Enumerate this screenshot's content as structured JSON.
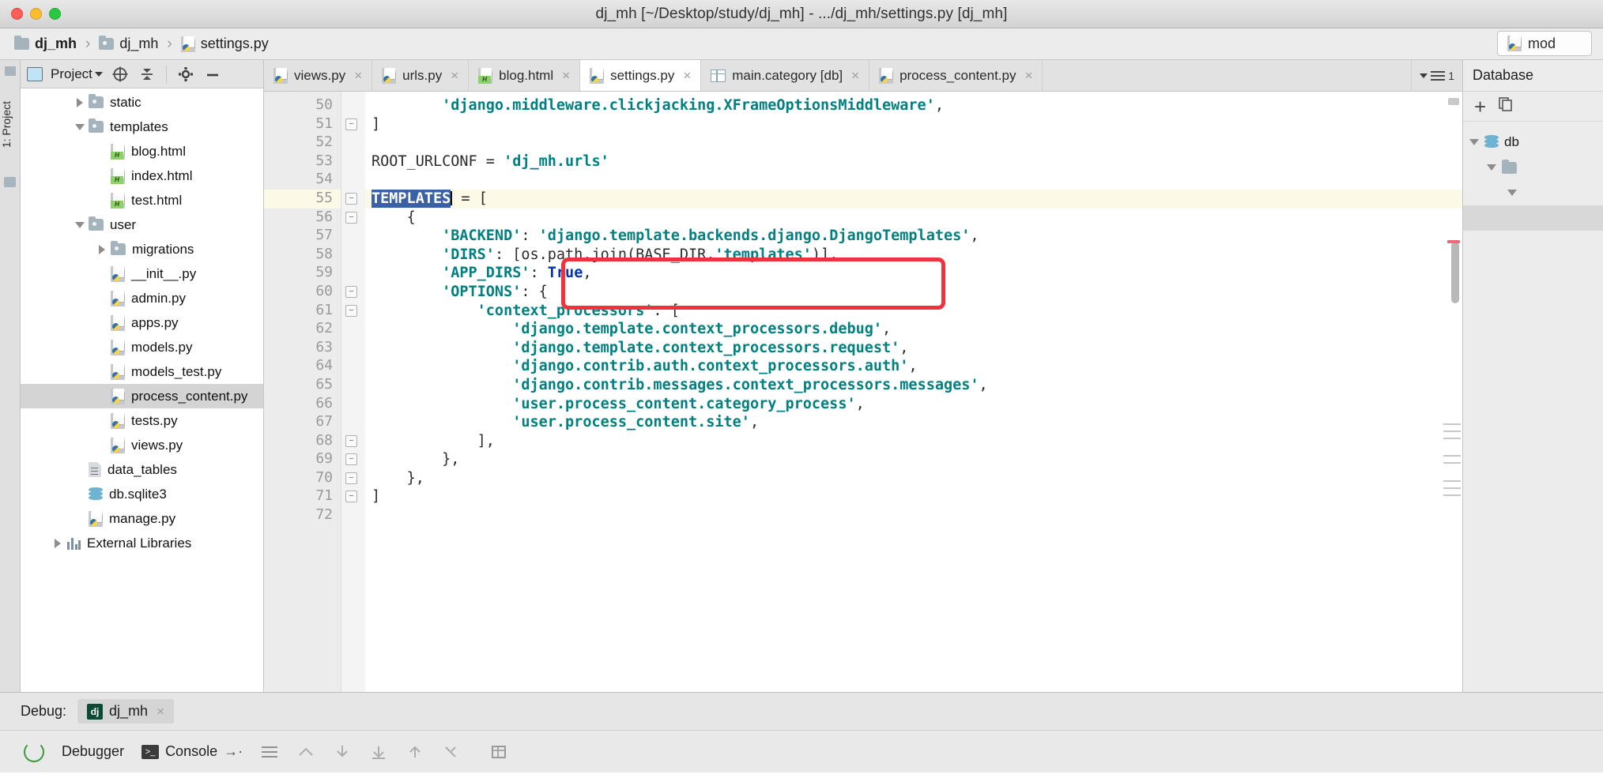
{
  "window": {
    "title": "dj_mh [~/Desktop/study/dj_mh] - .../dj_mh/settings.py [dj_mh]"
  },
  "breadcrumb": {
    "items": [
      {
        "label": "dj_mh",
        "icon": "folder-icon"
      },
      {
        "label": "dj_mh",
        "icon": "folder-icon"
      },
      {
        "label": "settings.py",
        "icon": "python-file-icon"
      }
    ],
    "separator": "›",
    "module_button": "mod"
  },
  "left_stripe": {
    "label": "1: Project"
  },
  "project_panel": {
    "title": "Project",
    "tools": [
      "locate-icon",
      "collapse-all-icon",
      "settings-gear-icon",
      "minimize-icon"
    ],
    "tree": [
      {
        "label": "static",
        "depth": 2,
        "state": "collapsed",
        "icon": "folder-icon",
        "selected": false
      },
      {
        "label": "templates",
        "depth": 2,
        "state": "expanded",
        "icon": "folder-icon",
        "selected": false
      },
      {
        "label": "blog.html",
        "depth": 3,
        "state": "leaf",
        "icon": "html-file-icon",
        "selected": false
      },
      {
        "label": "index.html",
        "depth": 3,
        "state": "leaf",
        "icon": "html-file-icon",
        "selected": false
      },
      {
        "label": "test.html",
        "depth": 3,
        "state": "leaf",
        "icon": "html-file-icon",
        "selected": false
      },
      {
        "label": "user",
        "depth": 2,
        "state": "expanded",
        "icon": "folder-icon",
        "selected": false
      },
      {
        "label": "migrations",
        "depth": 3,
        "state": "collapsed",
        "icon": "folder-icon",
        "selected": false
      },
      {
        "label": "__init__.py",
        "depth": 3,
        "state": "leaf",
        "icon": "python-file-icon",
        "selected": false
      },
      {
        "label": "admin.py",
        "depth": 3,
        "state": "leaf",
        "icon": "python-file-icon",
        "selected": false
      },
      {
        "label": "apps.py",
        "depth": 3,
        "state": "leaf",
        "icon": "python-file-icon",
        "selected": false
      },
      {
        "label": "models.py",
        "depth": 3,
        "state": "leaf",
        "icon": "python-file-icon",
        "selected": false
      },
      {
        "label": "models_test.py",
        "depth": 3,
        "state": "leaf",
        "icon": "python-file-icon",
        "selected": false
      },
      {
        "label": "process_content.py",
        "depth": 3,
        "state": "leaf",
        "icon": "python-file-icon",
        "selected": true
      },
      {
        "label": "tests.py",
        "depth": 3,
        "state": "leaf",
        "icon": "python-file-icon",
        "selected": false
      },
      {
        "label": "views.py",
        "depth": 3,
        "state": "leaf",
        "icon": "python-file-icon",
        "selected": false
      },
      {
        "label": "data_tables",
        "depth": 2,
        "state": "leaf",
        "icon": "document-icon",
        "selected": false
      },
      {
        "label": "db.sqlite3",
        "depth": 2,
        "state": "leaf",
        "icon": "database-icon",
        "selected": false
      },
      {
        "label": "manage.py",
        "depth": 2,
        "state": "leaf",
        "icon": "python-file-icon",
        "selected": false
      },
      {
        "label": "External Libraries",
        "depth": 1,
        "state": "collapsed",
        "icon": "library-icon",
        "selected": false
      }
    ]
  },
  "editor": {
    "tabs": [
      {
        "label": "views.py",
        "icon": "python-file-icon",
        "active": false,
        "close": "×"
      },
      {
        "label": "urls.py",
        "icon": "python-file-icon",
        "active": false,
        "close": "×"
      },
      {
        "label": "blog.html",
        "icon": "html-file-icon",
        "active": false,
        "close": "×"
      },
      {
        "label": "settings.py",
        "icon": "python-file-icon",
        "active": true,
        "close": "×"
      },
      {
        "label": "main.category [db]",
        "icon": "table-icon",
        "active": false,
        "close": "×"
      },
      {
        "label": "process_content.py",
        "icon": "python-file-icon",
        "active": false,
        "close": "×"
      }
    ],
    "tab_overflow_count": "1",
    "first_line_number": 50,
    "current_line": 55,
    "selection_text": "TEMPLATES",
    "lines": [
      {
        "n": 50,
        "indent": 8,
        "tokens": [
          {
            "t": "'django.middleware.clickjacking.XFrameOptionsMiddleware'",
            "c": "str"
          },
          {
            "t": ",",
            "c": "pl"
          }
        ],
        "fold": ""
      },
      {
        "n": 51,
        "indent": 0,
        "tokens": [
          {
            "t": "]",
            "c": "pl"
          }
        ],
        "fold": "end"
      },
      {
        "n": 52,
        "indent": 0,
        "tokens": [],
        "fold": ""
      },
      {
        "n": 53,
        "indent": 0,
        "tokens": [
          {
            "t": "ROOT_URLCONF = ",
            "c": "pl"
          },
          {
            "t": "'dj_mh.urls'",
            "c": "str"
          }
        ],
        "fold": ""
      },
      {
        "n": 54,
        "indent": 0,
        "tokens": [],
        "fold": ""
      },
      {
        "n": 55,
        "indent": 0,
        "tokens": [
          {
            "t": "TEMPLATES",
            "c": "sel"
          },
          {
            "t": " = [",
            "c": "pl"
          }
        ],
        "fold": "start"
      },
      {
        "n": 56,
        "indent": 4,
        "tokens": [
          {
            "t": "{",
            "c": "pl"
          }
        ],
        "fold": "start"
      },
      {
        "n": 57,
        "indent": 8,
        "tokens": [
          {
            "t": "'BACKEND'",
            "c": "str"
          },
          {
            "t": ": ",
            "c": "pl"
          },
          {
            "t": "'django.template.backends.django.DjangoTemplates'",
            "c": "str"
          },
          {
            "t": ",",
            "c": "pl"
          }
        ],
        "fold": ""
      },
      {
        "n": 58,
        "indent": 8,
        "tokens": [
          {
            "t": "'DIRS'",
            "c": "str"
          },
          {
            "t": ": [os.path.join(BASE_DIR,",
            "c": "pl"
          },
          {
            "t": "'templates'",
            "c": "str"
          },
          {
            "t": ")],",
            "c": "pl"
          }
        ],
        "fold": ""
      },
      {
        "n": 59,
        "indent": 8,
        "tokens": [
          {
            "t": "'APP_DIRS'",
            "c": "str"
          },
          {
            "t": ": ",
            "c": "pl"
          },
          {
            "t": "True",
            "c": "kw"
          },
          {
            "t": ",",
            "c": "pl"
          }
        ],
        "fold": ""
      },
      {
        "n": 60,
        "indent": 8,
        "tokens": [
          {
            "t": "'OPTIONS'",
            "c": "str"
          },
          {
            "t": ": {",
            "c": "pl"
          }
        ],
        "fold": "start"
      },
      {
        "n": 61,
        "indent": 12,
        "tokens": [
          {
            "t": "'context_processors'",
            "c": "str"
          },
          {
            "t": ": [",
            "c": "pl"
          }
        ],
        "fold": "start"
      },
      {
        "n": 62,
        "indent": 16,
        "tokens": [
          {
            "t": "'django.template.context_processors.debug'",
            "c": "str"
          },
          {
            "t": ",",
            "c": "pl"
          }
        ],
        "fold": ""
      },
      {
        "n": 63,
        "indent": 16,
        "tokens": [
          {
            "t": "'django.template.context_processors.request'",
            "c": "str"
          },
          {
            "t": ",",
            "c": "pl"
          }
        ],
        "fold": ""
      },
      {
        "n": 64,
        "indent": 16,
        "tokens": [
          {
            "t": "'django.contrib.auth.context_processors.auth'",
            "c": "str"
          },
          {
            "t": ",",
            "c": "pl"
          }
        ],
        "fold": ""
      },
      {
        "n": 65,
        "indent": 16,
        "tokens": [
          {
            "t": "'django.contrib.messages.context_processors.messages'",
            "c": "str"
          },
          {
            "t": ",",
            "c": "pl"
          }
        ],
        "fold": ""
      },
      {
        "n": 66,
        "indent": 16,
        "tokens": [
          {
            "t": "'user.process_content.category_process'",
            "c": "str"
          },
          {
            "t": ",",
            "c": "pl"
          }
        ],
        "fold": ""
      },
      {
        "n": 67,
        "indent": 16,
        "tokens": [
          {
            "t": "'user.process_content.site'",
            "c": "str"
          },
          {
            "t": ",",
            "c": "pl"
          }
        ],
        "fold": ""
      },
      {
        "n": 68,
        "indent": 12,
        "tokens": [
          {
            "t": "],",
            "c": "pl"
          }
        ],
        "fold": "end"
      },
      {
        "n": 69,
        "indent": 8,
        "tokens": [
          {
            "t": "},",
            "c": "pl"
          }
        ],
        "fold": "end"
      },
      {
        "n": 70,
        "indent": 4,
        "tokens": [
          {
            "t": "},",
            "c": "pl"
          }
        ],
        "fold": "end"
      },
      {
        "n": 71,
        "indent": 0,
        "tokens": [
          {
            "t": "]",
            "c": "pl"
          }
        ],
        "fold": "end"
      },
      {
        "n": 72,
        "indent": 0,
        "tokens": [],
        "fold": ""
      }
    ],
    "annotation": {
      "type": "red-rectangle-highlight",
      "color": "#f0323c",
      "covers_lines": [
        66,
        67
      ]
    }
  },
  "database_panel": {
    "title": "Database",
    "tools": [
      "add-icon",
      "copy-icon"
    ],
    "rows": [
      {
        "label": "db",
        "icon": "database-icon",
        "expanded": true
      },
      {
        "label": "",
        "icon": "folder-icon",
        "expanded": true
      },
      {
        "label": "",
        "icon": "chevron-down-icon",
        "expanded": false
      }
    ]
  },
  "debug_panel": {
    "label": "Debug:",
    "session": "dj_mh",
    "session_icon": "django-icon",
    "close": "×",
    "tabs": [
      {
        "label": "Debugger",
        "icon": "debugger-icon",
        "active": false
      },
      {
        "label": "Console",
        "icon": "console-icon",
        "active": true
      }
    ],
    "arrow": "→·",
    "tools": [
      "list-icon",
      "step-up-icon",
      "step-down-icon",
      "export-icon",
      "import-icon",
      "cut-icon",
      "grid-icon"
    ],
    "restart_icon": "restart-icon"
  }
}
